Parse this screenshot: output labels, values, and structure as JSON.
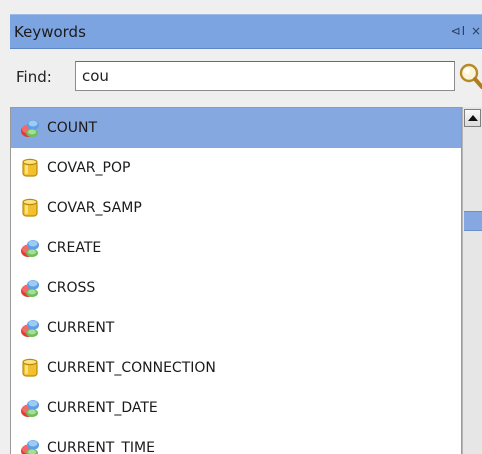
{
  "panel": {
    "title": "Keywords",
    "controls": "⊲I ×"
  },
  "find": {
    "label": "Find:",
    "value": "cou"
  },
  "keywords": [
    {
      "label": "COUNT",
      "icon": "function-icon",
      "selected": true
    },
    {
      "label": "COVAR_POP",
      "icon": "database-icon",
      "selected": false
    },
    {
      "label": "COVAR_SAMP",
      "icon": "database-icon",
      "selected": false
    },
    {
      "label": "CREATE",
      "icon": "function-icon",
      "selected": false
    },
    {
      "label": "CROSS",
      "icon": "function-icon",
      "selected": false
    },
    {
      "label": "CURRENT",
      "icon": "function-icon",
      "selected": false
    },
    {
      "label": "CURRENT_CONNECTION",
      "icon": "database-icon",
      "selected": false
    },
    {
      "label": "CURRENT_DATE",
      "icon": "function-icon",
      "selected": false
    },
    {
      "label": "CURRENT_TIME",
      "icon": "function-icon",
      "selected": false
    }
  ],
  "colors": {
    "titlebar": "#7ba4e0",
    "selection": "#86a8e0"
  }
}
